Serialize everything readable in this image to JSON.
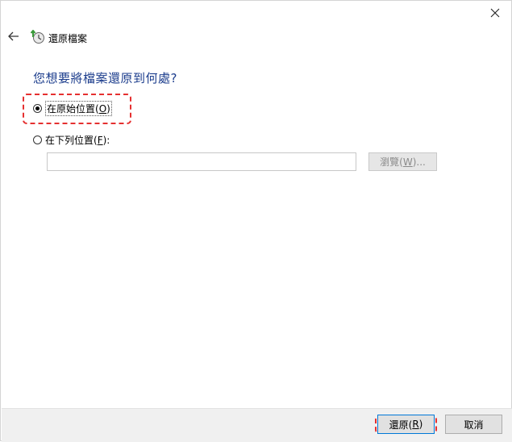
{
  "window": {
    "title": "還原檔案",
    "close_glyph": "✕",
    "back_glyph": "←"
  },
  "heading": "您想要將檔案還原到何處?",
  "options": [
    {
      "label_pre": "在原始位置(",
      "mnemonic": "O",
      "label_post": ")",
      "selected": true
    },
    {
      "label_pre": "在下列位置(",
      "mnemonic": "F",
      "label_post": "):",
      "selected": false
    }
  ],
  "path_input": {
    "value": ""
  },
  "browse": {
    "label_pre": "瀏覽(",
    "mnemonic": "W",
    "label_post": ")...",
    "enabled": false
  },
  "footer": {
    "restore": {
      "label_pre": "還原(",
      "mnemonic": "R",
      "label_post": ")"
    },
    "cancel": {
      "label": "取消"
    }
  },
  "colors": {
    "heading": "#1b3c8c",
    "highlight": "#e53030",
    "accent": "#0078d7"
  }
}
